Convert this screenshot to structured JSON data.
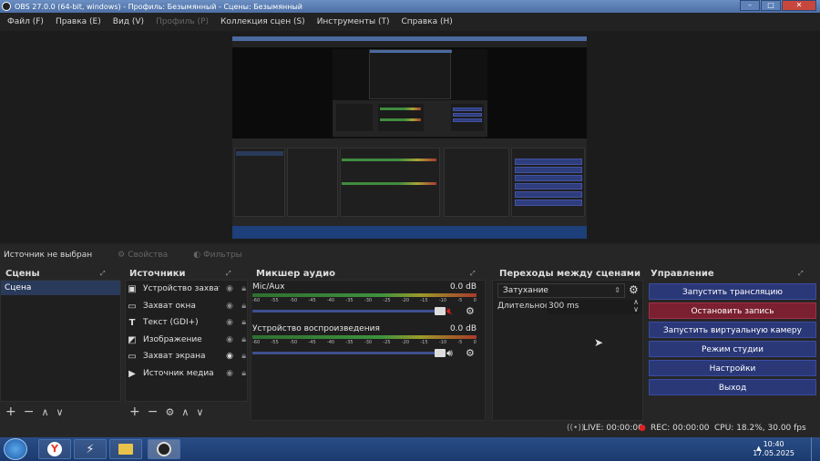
{
  "window": {
    "title": "OBS 27.0.0 (64-bit, windows) - Профиль: Безымянный - Сцены: Безымянный"
  },
  "menu": [
    {
      "label": "Файл (F)",
      "enabled": true
    },
    {
      "label": "Правка (E)",
      "enabled": true
    },
    {
      "label": "Вид (V)",
      "enabled": true
    },
    {
      "label": "Профиль (P)",
      "enabled": false
    },
    {
      "label": "Коллекция сцен (S)",
      "enabled": true
    },
    {
      "label": "Инструменты (T)",
      "enabled": true
    },
    {
      "label": "Справка (H)",
      "enabled": true
    }
  ],
  "source_bar": {
    "no_source": "Источник не выбран",
    "properties": "Свойства",
    "filters": "Фильтры"
  },
  "scenes": {
    "title": "Сцены",
    "items": [
      "Сцена"
    ]
  },
  "sources": {
    "title": "Источники",
    "items": [
      {
        "label": "Устройство захвата видео",
        "icon": "camera-icon"
      },
      {
        "label": "Захват окна",
        "icon": "window-icon"
      },
      {
        "label": "Текст (GDI+)",
        "icon": "text-icon"
      },
      {
        "label": "Изображение",
        "icon": "image-icon"
      },
      {
        "label": "Захват экрана",
        "icon": "monitor-icon"
      },
      {
        "label": "Источник медиа",
        "icon": "play-icon"
      }
    ]
  },
  "mixer": {
    "title": "Микшер аудио",
    "channels": [
      {
        "name": "Mic/Aux",
        "db": "0.0 dB",
        "muted": true,
        "volume": 1.0
      },
      {
        "name": "Устройство воспроизведения",
        "db": "0.0 dB",
        "muted": false,
        "volume": 1.0
      }
    ],
    "ticks": [
      "-60",
      "-55",
      "-50",
      "-45",
      "-40",
      "-35",
      "-30",
      "-25",
      "-20",
      "-15",
      "-10",
      "-5",
      "0"
    ]
  },
  "transitions": {
    "title": "Переходы между сценами",
    "selected": "Затухание",
    "duration_label": "Длительность",
    "duration_value": "300 ms"
  },
  "controls": {
    "title": "Управление",
    "buttons": [
      "Запустить трансляцию",
      "Остановить запись",
      "Запустить виртуальную камеру",
      "Режим студии",
      "Настройки",
      "Выход"
    ]
  },
  "status": {
    "live": "LIVE: 00:00:00",
    "rec": "REC: 00:00:00",
    "cpu": "CPU: 18.2%, 30.00 fps"
  },
  "taskbar": {
    "time": "10:40",
    "date": "17.05.2025"
  },
  "colors": {
    "accent": "#2a3878",
    "rec": "#7a2030",
    "meter_green": "#3e923e",
    "meter_red": "#a83a2b"
  }
}
